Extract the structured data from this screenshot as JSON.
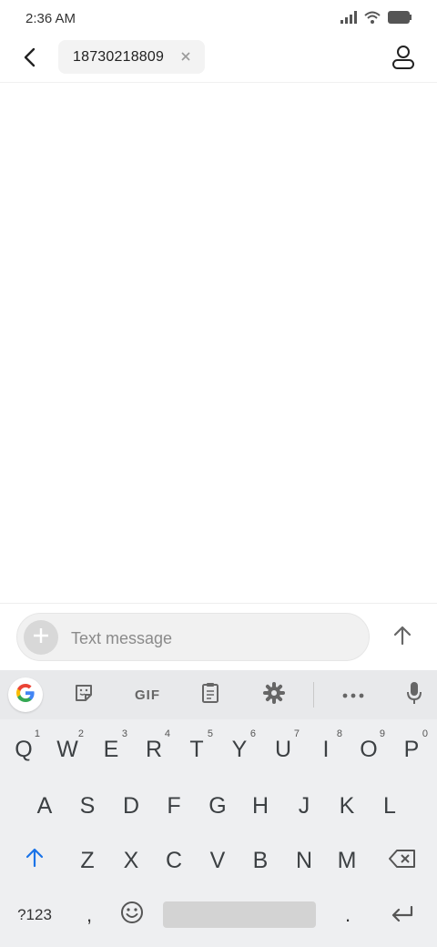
{
  "status_bar": {
    "time": "2:36 AM",
    "icons": [
      "signal-icon",
      "wifi-icon",
      "battery-icon"
    ]
  },
  "header": {
    "back_icon": "back-arrow-icon",
    "recipient_chip": {
      "text": "18730218809",
      "remove_icon": "close-icon"
    },
    "contact_icon": "person-icon"
  },
  "composer": {
    "add_icon": "plus-icon",
    "input_value": "",
    "input_placeholder": "Text message",
    "send_icon": "arrow-up-icon"
  },
  "keyboard": {
    "toolbar": {
      "google_icon": "google-g-icon",
      "sticker_icon": "sticker-icon",
      "gif_label": "GIF",
      "clipboard_icon": "clipboard-icon",
      "settings_icon": "gear-icon",
      "more_icon": "more-horizontal-icon",
      "mic_icon": "microphone-icon"
    },
    "row1": [
      {
        "key": "Q",
        "hint": "1"
      },
      {
        "key": "W",
        "hint": "2"
      },
      {
        "key": "E",
        "hint": "3"
      },
      {
        "key": "R",
        "hint": "4"
      },
      {
        "key": "T",
        "hint": "5"
      },
      {
        "key": "Y",
        "hint": "6"
      },
      {
        "key": "U",
        "hint": "7"
      },
      {
        "key": "I",
        "hint": "8"
      },
      {
        "key": "O",
        "hint": "9"
      },
      {
        "key": "P",
        "hint": "0"
      }
    ],
    "row2": [
      "A",
      "S",
      "D",
      "F",
      "G",
      "H",
      "J",
      "K",
      "L"
    ],
    "row3": [
      "Z",
      "X",
      "C",
      "V",
      "B",
      "N",
      "M"
    ],
    "shift_icon": "shift-arrow-icon",
    "backspace_icon": "backspace-icon",
    "row4": {
      "symbols_label": "?123",
      "comma_label": ",",
      "emoji_icon": "emoji-icon",
      "period_label": ".",
      "enter_icon": "enter-icon"
    }
  },
  "colors": {
    "shift_accent": "#1a73e8",
    "keyboard_bg": "#eeeff1",
    "chip_bg": "#f3f3f3"
  }
}
